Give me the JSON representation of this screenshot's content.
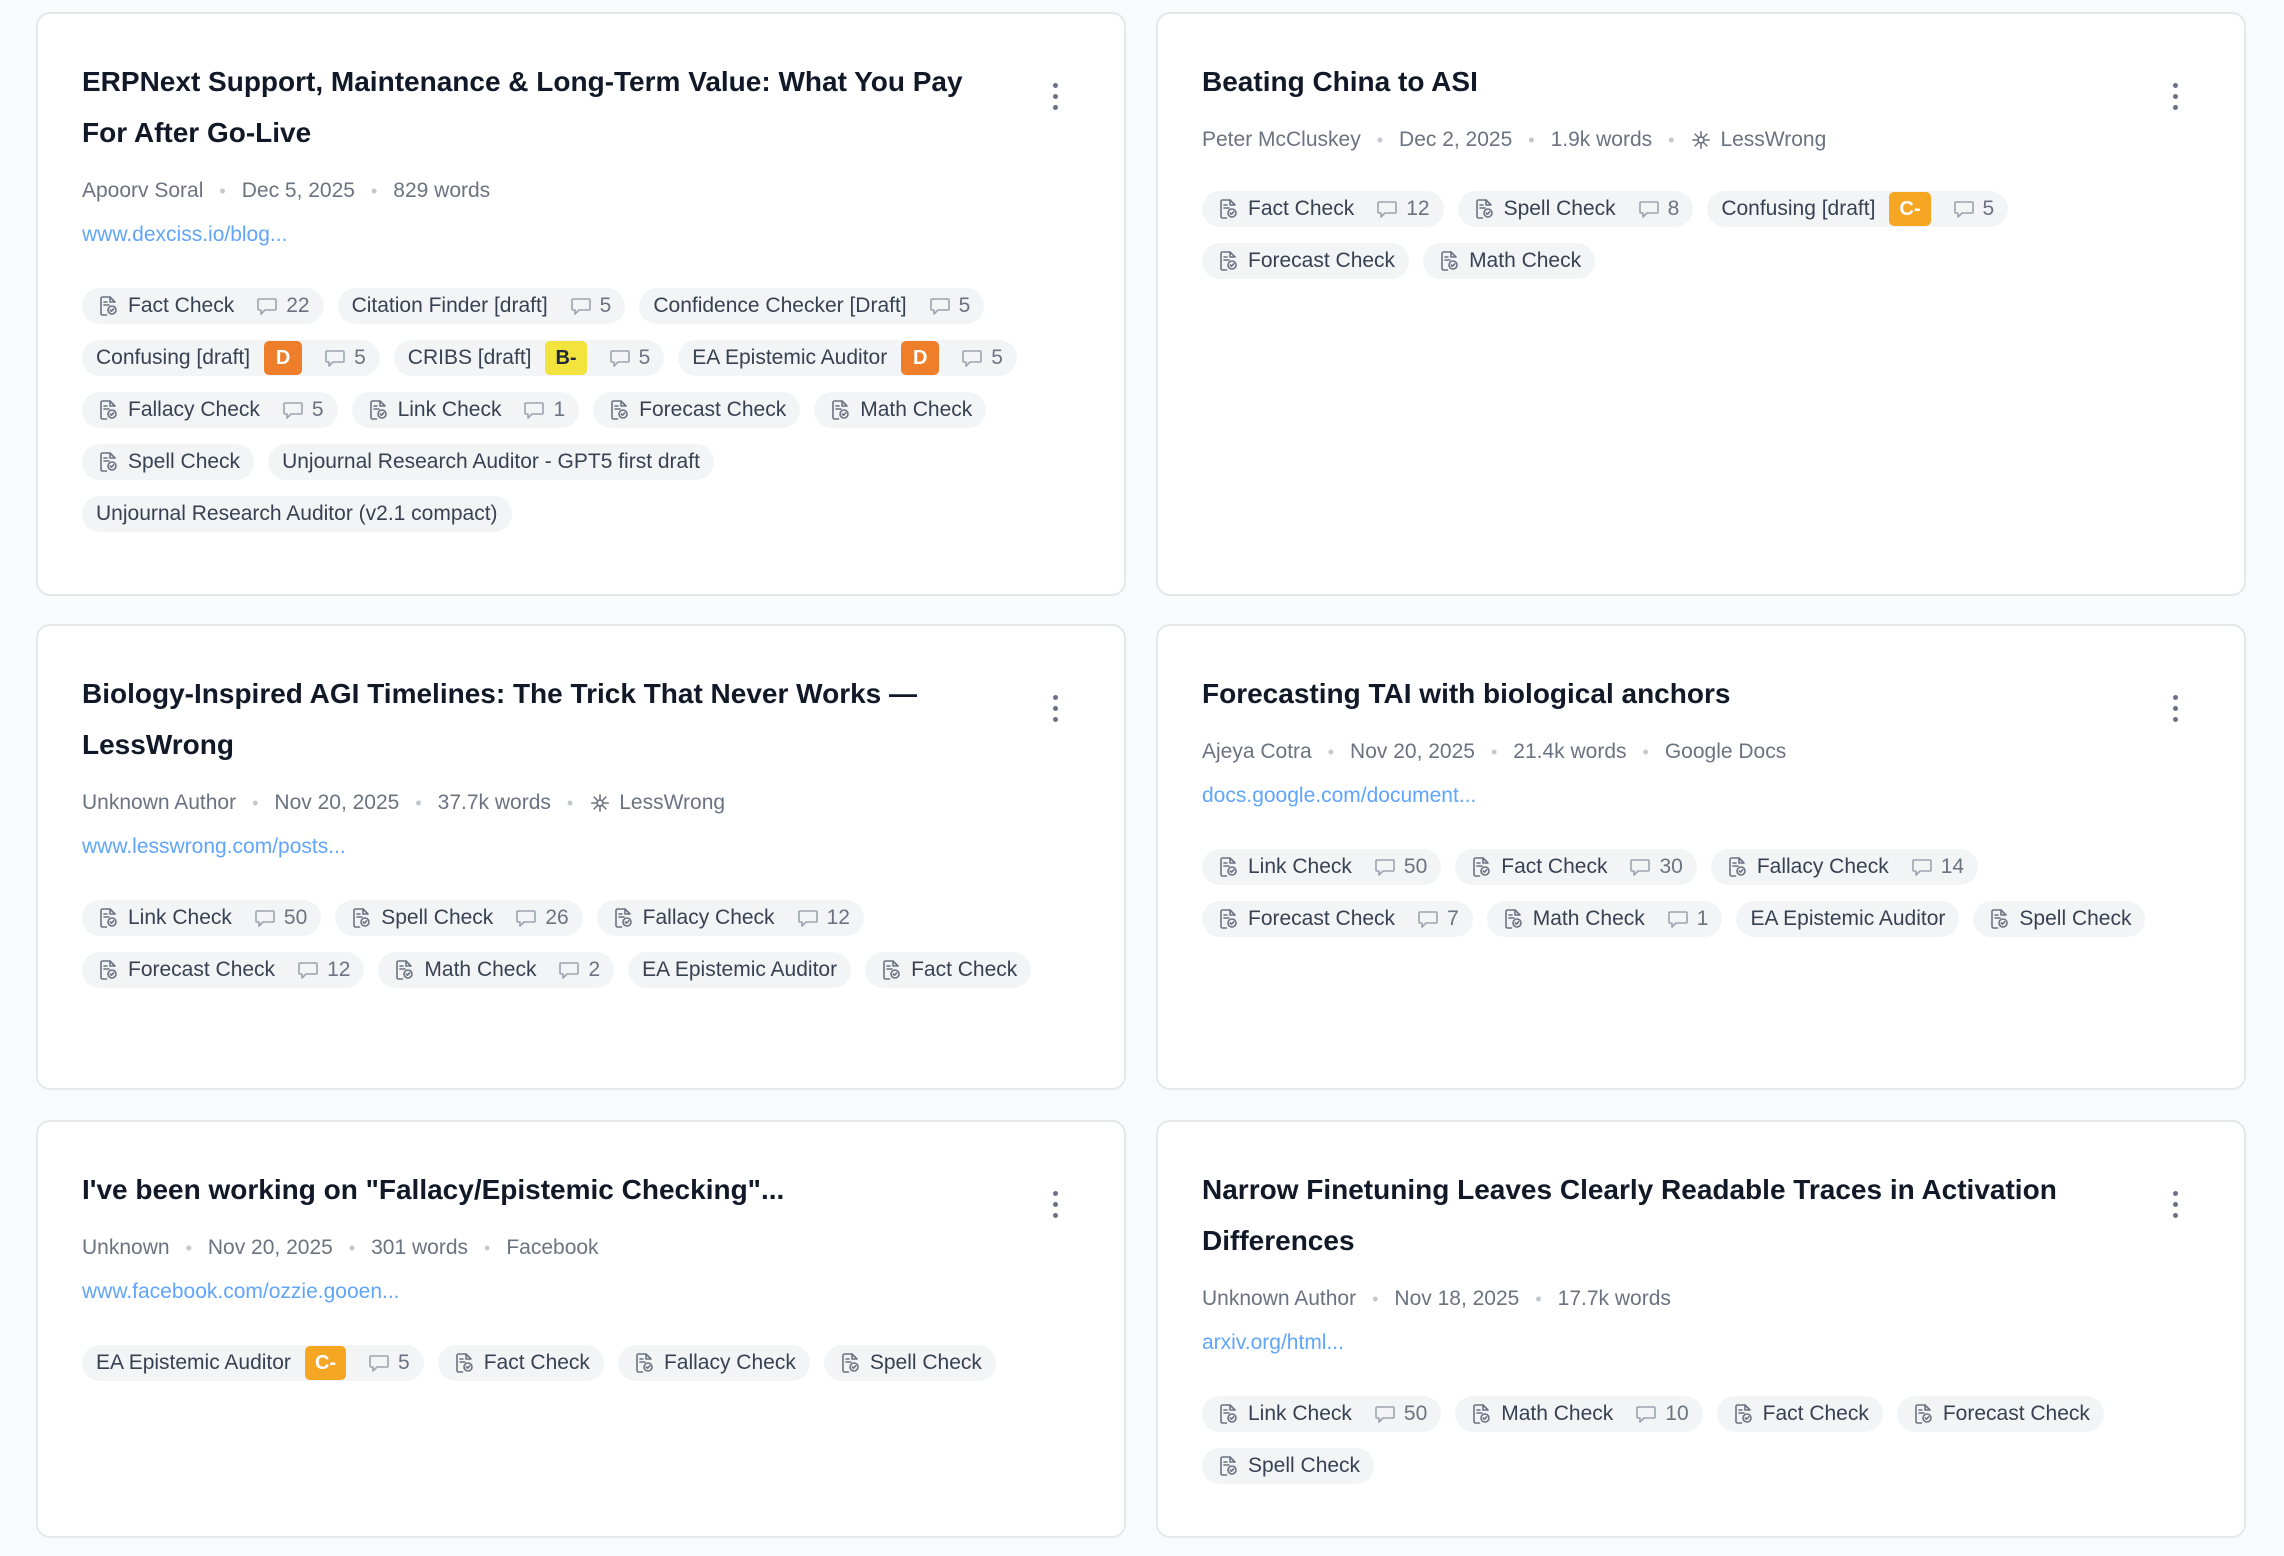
{
  "colors": {
    "grade_D": "#ef7e2a",
    "grade_C-": "#f5a623",
    "grade_B-": "#f2e33d",
    "link": "#60a5fa",
    "muted": "#6b7280"
  },
  "cards": [
    {
      "title": "ERPNext Support, Maintenance & Long-Term Value: What You Pay For After Go-Live",
      "author": "Apoorv Soral",
      "date": "Dec 5, 2025",
      "words": "829 words",
      "source": "",
      "link": "www.dexciss.io/blog...",
      "tags": [
        {
          "label": "Fact Check",
          "icon": "fact-check-icon",
          "comments": "22"
        },
        {
          "label": "Citation Finder [draft]",
          "comments": "5"
        },
        {
          "label": "Confidence Checker [Draft]",
          "comments": "5"
        },
        {
          "label": "Confusing [draft]",
          "grade": "D",
          "comments": "5"
        },
        {
          "label": "CRIBS [draft]",
          "grade": "B-",
          "comments": "5"
        },
        {
          "label": "EA Epistemic Auditor",
          "grade": "D",
          "comments": "5"
        },
        {
          "label": "Fallacy Check",
          "icon": "fallacy-check-icon",
          "comments": "5"
        },
        {
          "label": "Link Check",
          "icon": "link-check-icon",
          "comments": "1"
        },
        {
          "label": "Forecast Check",
          "icon": "forecast-check-icon"
        },
        {
          "label": "Math Check",
          "icon": "math-check-icon"
        },
        {
          "label": "Spell Check",
          "icon": "spell-check-icon"
        },
        {
          "label": "Unjournal Research Auditor - GPT5 first draft"
        },
        {
          "label": "Unjournal Research Auditor (v2.1 compact)"
        }
      ]
    },
    {
      "title": "Beating China to ASI",
      "author": "Peter McCluskey",
      "date": "Dec 2, 2025",
      "words": "1.9k words",
      "source": "LessWrong",
      "link": "",
      "tags": [
        {
          "label": "Fact Check",
          "icon": "fact-check-icon",
          "comments": "12"
        },
        {
          "label": "Spell Check",
          "icon": "spell-check-icon",
          "comments": "8"
        },
        {
          "label": "Confusing [draft]",
          "grade": "C-",
          "comments": "5"
        },
        {
          "label": "Forecast Check",
          "icon": "forecast-check-icon"
        },
        {
          "label": "Math Check",
          "icon": "math-check-icon"
        }
      ]
    },
    {
      "title": "Biology-Inspired AGI Timelines: The Trick That Never Works — LessWrong",
      "author": "Unknown Author",
      "date": "Nov 20, 2025",
      "words": "37.7k words",
      "source": "LessWrong",
      "link": "www.lesswrong.com/posts...",
      "tags": [
        {
          "label": "Link Check",
          "icon": "link-check-icon",
          "comments": "50"
        },
        {
          "label": "Spell Check",
          "icon": "spell-check-icon",
          "comments": "26"
        },
        {
          "label": "Fallacy Check",
          "icon": "fallacy-check-icon",
          "comments": "12"
        },
        {
          "label": "Forecast Check",
          "icon": "forecast-check-icon",
          "comments": "12"
        },
        {
          "label": "Math Check",
          "icon": "math-check-icon",
          "comments": "2"
        },
        {
          "label": "EA Epistemic Auditor"
        },
        {
          "label": "Fact Check",
          "icon": "fact-check-icon"
        }
      ]
    },
    {
      "title": "Forecasting TAI with biological anchors",
      "author": "Ajeya Cotra",
      "date": "Nov 20, 2025",
      "words": "21.4k words",
      "source": "Google Docs",
      "link": "docs.google.com/document...",
      "tags": [
        {
          "label": "Link Check",
          "icon": "link-check-icon",
          "comments": "50"
        },
        {
          "label": "Fact Check",
          "icon": "fact-check-icon",
          "comments": "30"
        },
        {
          "label": "Fallacy Check",
          "icon": "fallacy-check-icon",
          "comments": "14"
        },
        {
          "label": "Forecast Check",
          "icon": "forecast-check-icon",
          "comments": "7"
        },
        {
          "label": "Math Check",
          "icon": "math-check-icon",
          "comments": "1"
        },
        {
          "label": "EA Epistemic Auditor"
        },
        {
          "label": "Spell Check",
          "icon": "spell-check-icon"
        }
      ]
    },
    {
      "title": "I've been working on \"Fallacy/Epistemic Checking\"...",
      "author": "Unknown",
      "date": "Nov 20, 2025",
      "words": "301 words",
      "source": "Facebook",
      "link": "www.facebook.com/ozzie.gooen...",
      "tags": [
        {
          "label": "EA Epistemic Auditor",
          "grade": "C-",
          "comments": "5"
        },
        {
          "label": "Fact Check",
          "icon": "fact-check-icon"
        },
        {
          "label": "Fallacy Check",
          "icon": "fallacy-check-icon"
        },
        {
          "label": "Spell Check",
          "icon": "spell-check-icon"
        }
      ]
    },
    {
      "title": "Narrow Finetuning Leaves Clearly Readable Traces in Activation Differences",
      "author": "Unknown Author",
      "date": "Nov 18, 2025",
      "words": "17.7k words",
      "source": "",
      "link": "arxiv.org/html...",
      "tags": [
        {
          "label": "Link Check",
          "icon": "link-check-icon",
          "comments": "50"
        },
        {
          "label": "Math Check",
          "icon": "math-check-icon",
          "comments": "10"
        },
        {
          "label": "Fact Check",
          "icon": "fact-check-icon"
        },
        {
          "label": "Forecast Check",
          "icon": "forecast-check-icon"
        },
        {
          "label": "Spell Check",
          "icon": "spell-check-icon"
        }
      ]
    }
  ]
}
